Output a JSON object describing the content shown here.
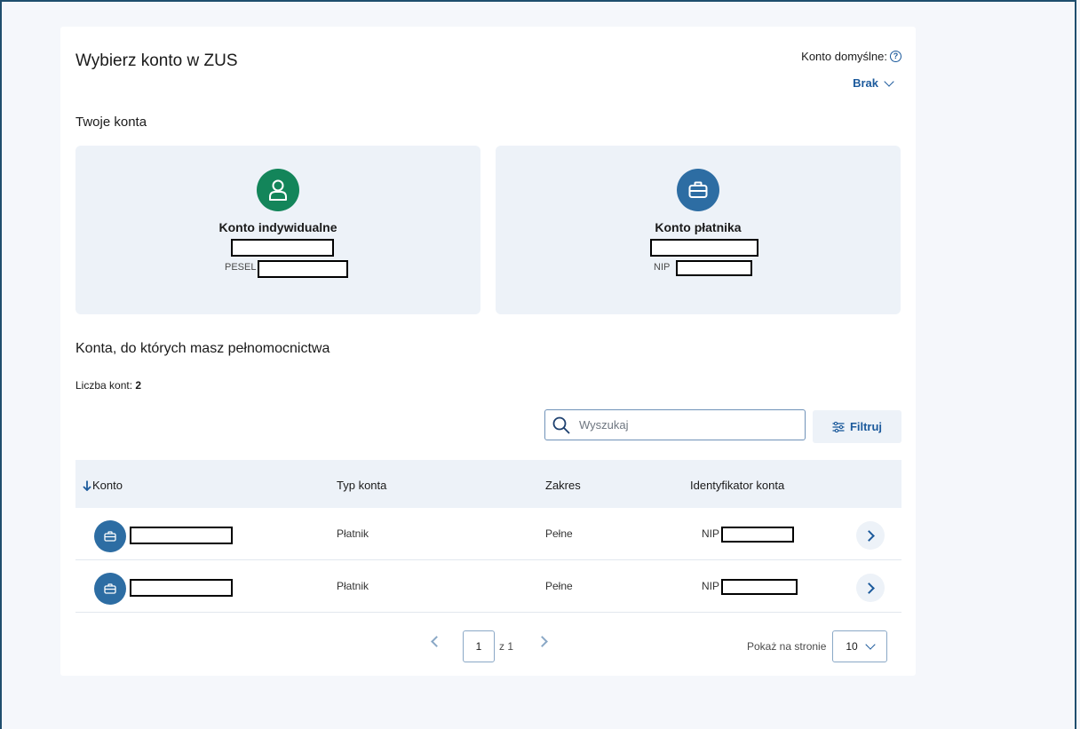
{
  "header": {
    "title": "Wybierz konto w ZUS",
    "default_account_label": "Konto domyślne:",
    "default_account_value": "Brak"
  },
  "own_accounts": {
    "section_title": "Twoje konta",
    "items": [
      {
        "name": "Konto indywidualne",
        "id_type": "PESEL",
        "icon": "user-icon",
        "icon_color": "#13855a"
      },
      {
        "name": "Konto płatnika",
        "id_type": "NIP",
        "icon": "briefcase-icon",
        "icon_color": "#2d6da3"
      }
    ]
  },
  "proxy_accounts": {
    "section_title": "Konta, do których masz pełnomocnictwa",
    "count_label": "Liczba kont:",
    "count_value": "2",
    "search_placeholder": "Wyszukaj",
    "filter_label": "Filtruj",
    "columns": [
      "Konto",
      "Typ konta",
      "Zakres",
      "Identyfikator konta"
    ],
    "rows": [
      {
        "type": "Płatnik",
        "scope": "Pełne",
        "id_type": "NIP"
      },
      {
        "type": "Płatnik",
        "scope": "Pełne",
        "id_type": "NIP"
      }
    ]
  },
  "pagination": {
    "current_page": "1",
    "of_label": "z 1",
    "per_page_label": "Pokaż na stronie",
    "per_page_value": "10"
  },
  "colors": {
    "accent": "#1c5a9c",
    "green": "#13855a",
    "blue_avatar": "#2d6da3",
    "tile_bg": "#edf2f8"
  }
}
